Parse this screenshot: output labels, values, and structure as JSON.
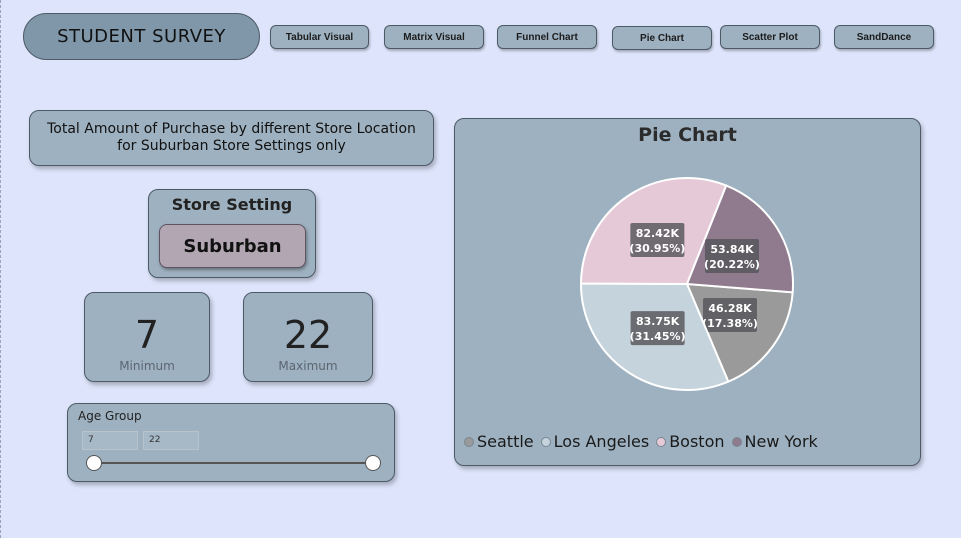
{
  "header": {
    "title": "STUDENT SURVEY"
  },
  "nav": {
    "buttons": [
      {
        "label": "Tabular Visual"
      },
      {
        "label": "Matrix Visual"
      },
      {
        "label": "Funnel Chart"
      },
      {
        "label": "Pie Chart"
      },
      {
        "label": "Scatter Plot"
      },
      {
        "label": "SandDance"
      }
    ]
  },
  "description": {
    "line1": "Total Amount of Purchase by different Store Location",
    "line2": "for Suburban Store Settings only"
  },
  "store_setting": {
    "label": "Store Setting",
    "value": "Suburban"
  },
  "kpis": {
    "minimum": {
      "value": "7",
      "label": "Minimum"
    },
    "maximum": {
      "value": "22",
      "label": "Maximum"
    }
  },
  "age_slider": {
    "title": "Age Group",
    "min_value": "7",
    "max_value": "22",
    "range_min": 7,
    "range_max": 22
  },
  "colors": {
    "background": "#dde4fb",
    "card": "#9eb1c0",
    "title_pill": "#7f97a9",
    "store_button": "#b3a6b3"
  },
  "chart_data": {
    "type": "pie",
    "title": "Pie Chart",
    "slices": [
      {
        "name": "Seattle",
        "value": 46.28,
        "value_label": "46.28K",
        "percent_label": "(17.38%)",
        "color": "#9a9a9a"
      },
      {
        "name": "Los Angeles",
        "value": 83.75,
        "value_label": "83.75K",
        "percent_label": "(31.45%)",
        "color": "#c5d3dc"
      },
      {
        "name": "Boston",
        "value": 82.42,
        "value_label": "82.42K",
        "percent_label": "(30.95%)",
        "color": "#e6c9d7"
      },
      {
        "name": "New York",
        "value": 53.84,
        "value_label": "53.84K",
        "percent_label": "(20.22%)",
        "color": "#8f7a8e"
      }
    ],
    "legend": [
      "Seattle",
      "Los Angeles",
      "Boston",
      "New York"
    ],
    "legend_position": "bottom-left"
  }
}
